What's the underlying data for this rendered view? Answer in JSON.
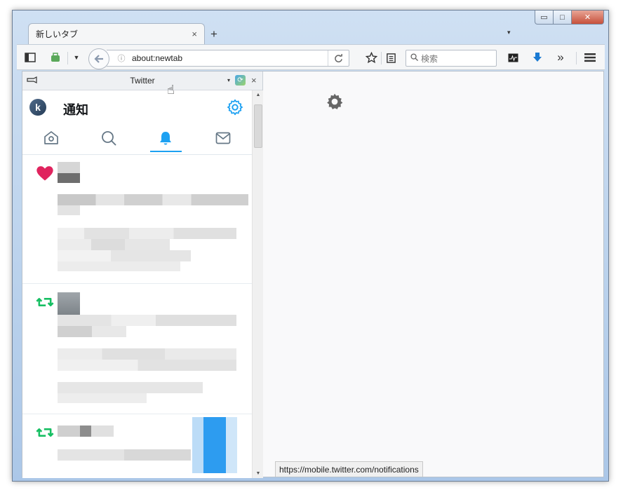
{
  "window": {
    "caption_min": "▭",
    "caption_max": "□",
    "caption_close": "✕"
  },
  "tabs": [
    {
      "title": "新しいタブ",
      "close": "×"
    }
  ],
  "tabbar": {
    "new_tab": "+",
    "list": "▾"
  },
  "navbar": {
    "url": "about:newtab",
    "url_info": "ⓘ",
    "search_placeholder": "検索",
    "overflow": "»"
  },
  "sidebar": {
    "title": "Twitter",
    "close": "×",
    "dropdown": "▾"
  },
  "twitter": {
    "page_title": "通知",
    "avatar_letter": "k",
    "active_tab": "notifications"
  },
  "statusbar": {
    "text": "https://mobile.twitter.com/notifications"
  },
  "colors": {
    "accent": "#1da1f2",
    "like": "#e0245e",
    "retweet": "#17bf63"
  }
}
